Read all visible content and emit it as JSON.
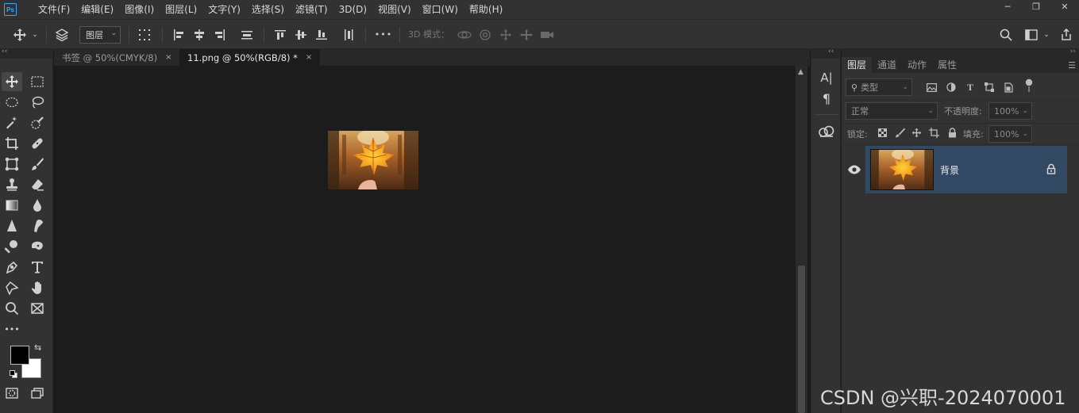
{
  "app": {
    "logo": "Ps"
  },
  "menu": [
    "文件(F)",
    "编辑(E)",
    "图像(I)",
    "图层(L)",
    "文字(Y)",
    "选择(S)",
    "滤镜(T)",
    "3D(D)",
    "视图(V)",
    "窗口(W)",
    "帮助(H)"
  ],
  "window_controls": {
    "minimize": "─",
    "restore": "❐",
    "close": "✕"
  },
  "options": {
    "auto_select_target": "图层",
    "mode_3d_label": "3D 模式：",
    "more": "•••"
  },
  "tabs": [
    {
      "label": "书签 @ 50%(CMYK/8)",
      "close": "×"
    },
    {
      "label": "11.png @ 50%(RGB/8) *",
      "close": "×"
    }
  ],
  "dock": {
    "character_label": "A|",
    "paragraph_label": "¶"
  },
  "panel": {
    "tabs": [
      "图层",
      "通道",
      "动作",
      "属性"
    ],
    "filter_kind": "类型",
    "blend_mode": "正常",
    "opacity_label": "不透明度:",
    "opacity_value": "100%",
    "lock_label": "锁定:",
    "fill_label": "填充:",
    "fill_value": "100%",
    "layers": [
      {
        "name": "背景",
        "visible": true,
        "locked": true,
        "selected": true
      }
    ]
  },
  "colors": {
    "foreground": "#000000",
    "background": "#ffffff",
    "accent": "#31a8ff",
    "selected_layer": "#324963"
  },
  "watermark": "CSDN @兴职-2024070001"
}
